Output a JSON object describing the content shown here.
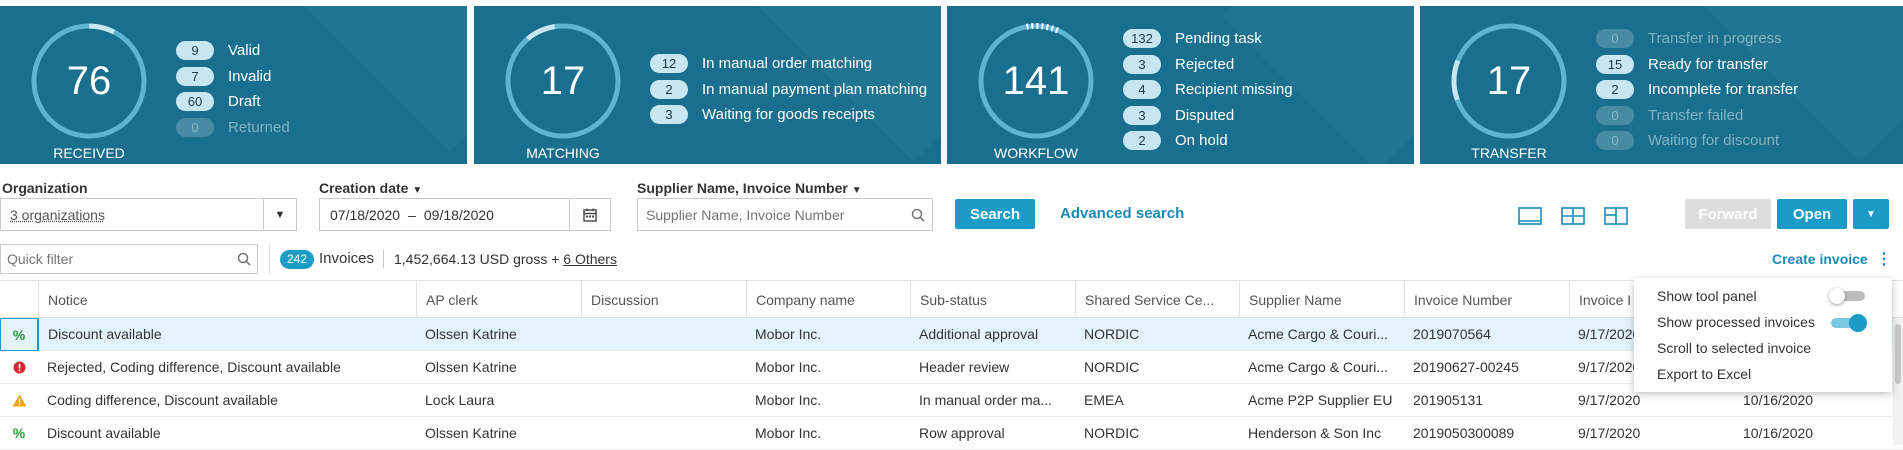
{
  "kpis": [
    {
      "number": "76",
      "label": "RECEIVED",
      "items": [
        {
          "count": "9",
          "text": "Valid",
          "dim": false
        },
        {
          "count": "7",
          "text": "Invalid",
          "dim": false
        },
        {
          "count": "60",
          "text": "Draft",
          "dim": false
        },
        {
          "count": "0",
          "text": "Returned",
          "dim": true
        }
      ]
    },
    {
      "number": "17",
      "label": "MATCHING",
      "items": [
        {
          "count": "12",
          "text": "In manual order matching",
          "dim": false
        },
        {
          "count": "2",
          "text": "In manual payment plan matching",
          "dim": false
        },
        {
          "count": "3",
          "text": "Waiting for goods receipts",
          "dim": false
        }
      ]
    },
    {
      "number": "141",
      "label": "WORKFLOW",
      "items": [
        {
          "count": "132",
          "text": "Pending task",
          "dim": false
        },
        {
          "count": "3",
          "text": "Rejected",
          "dim": false
        },
        {
          "count": "4",
          "text": "Recipient missing",
          "dim": false
        },
        {
          "count": "3",
          "text": "Disputed",
          "dim": false
        },
        {
          "count": "2",
          "text": "On hold",
          "dim": false
        }
      ]
    },
    {
      "number": "17",
      "label": "TRANSFER",
      "items": [
        {
          "count": "0",
          "text": "Transfer in progress",
          "dim": true
        },
        {
          "count": "15",
          "text": "Ready for transfer",
          "dim": false
        },
        {
          "count": "2",
          "text": "Incomplete for transfer",
          "dim": false
        },
        {
          "count": "0",
          "text": "Transfer failed",
          "dim": true
        },
        {
          "count": "0",
          "text": "Waiting for discount",
          "dim": true
        }
      ]
    }
  ],
  "filters": {
    "org_label": "Organization",
    "org_value": "3 organizations",
    "date_label": "Creation date",
    "date_from": "07/18/2020",
    "date_sep": "–",
    "date_to": "09/18/2020",
    "supplier_label": "Supplier Name, Invoice Number",
    "supplier_placeholder": "Supplier Name, Invoice Number",
    "search_button": "Search",
    "advanced_search": "Advanced search"
  },
  "actions": {
    "forward": "Forward",
    "open": "Open"
  },
  "summary": {
    "quick_filter_placeholder": "Quick filter",
    "count": "242",
    "count_label": "Invoices",
    "total": "1,452,664.13 USD gross + ",
    "others": "6 Others",
    "create_invoice": "Create invoice"
  },
  "columns": [
    "Notice",
    "AP clerk",
    "Discussion",
    "Company name",
    "Sub-status",
    "Shared Service Ce...",
    "Supplier Name",
    "Invoice Number",
    "Invoice I"
  ],
  "rows": [
    {
      "icon": "percent",
      "notice": "Discount available",
      "clerk": "Olssen Katrine",
      "discussion": "",
      "company": "Mobor Inc.",
      "substatus": "Additional approval",
      "ssc": "NORDIC",
      "supplier": "Acme Cargo & Couri...",
      "invoice": "2019070564",
      "date1": "9/17/2020",
      "date2": "",
      "selected": true
    },
    {
      "icon": "error",
      "notice": "Rejected, Coding difference, Discount available",
      "clerk": "Olssen Katrine",
      "discussion": "",
      "company": "Mobor Inc.",
      "substatus": "Header review",
      "ssc": "NORDIC",
      "supplier": "Acme Cargo & Couri...",
      "invoice": "20190627-00245",
      "date1": "9/17/2020",
      "date2": "",
      "selected": false
    },
    {
      "icon": "warning",
      "notice": "Coding difference, Discount available",
      "clerk": "Lock Laura",
      "discussion": "",
      "company": "Mobor Inc.",
      "substatus": "In manual order ma...",
      "ssc": "EMEA",
      "supplier": "Acme P2P Supplier EU",
      "invoice": "201905131",
      "date1": "9/17/2020",
      "date2": "10/16/2020",
      "selected": false
    },
    {
      "icon": "percent",
      "notice": "Discount available",
      "clerk": "Olssen Katrine",
      "discussion": "",
      "company": "Mobor Inc.",
      "substatus": "Row approval",
      "ssc": "NORDIC",
      "supplier": "Henderson & Son Inc",
      "invoice": "2019050300089",
      "date1": "9/17/2020",
      "date2": "10/16/2020",
      "selected": false
    }
  ],
  "menu": {
    "show_tool_panel": "Show tool panel",
    "show_processed": "Show processed invoices",
    "scroll_to_selected": "Scroll to selected invoice",
    "export_excel": "Export to Excel",
    "tool_panel_on": false,
    "processed_on": true
  },
  "colors": {
    "card": "#1a6f8f",
    "accent": "#1a9cc6",
    "selected_row": "#e3f3f9"
  }
}
